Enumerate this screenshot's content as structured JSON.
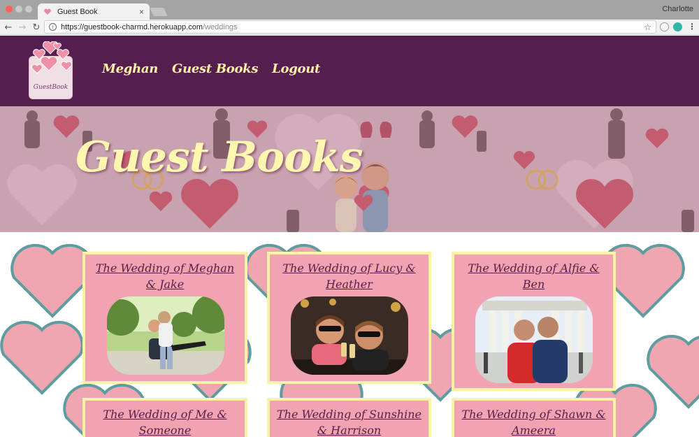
{
  "browser": {
    "tab_title": "Guest Book",
    "tab_close": "×",
    "profile_name": "Charlotte",
    "url_base": "https://guestbook-charmd.herokuapp.com",
    "url_path": "/weddings",
    "back_icon": "←",
    "forward_icon": "→",
    "reload_icon": "↻",
    "info_icon": "i",
    "star_icon": "☆",
    "menu_icon": "⋮"
  },
  "nav": {
    "logo_text": "GuestBook",
    "links": [
      "Meghan",
      "Guest Books",
      "Logout"
    ]
  },
  "hero": {
    "title": "Guest Books"
  },
  "cards": [
    {
      "title": "The Wedding of Meghan & Jake",
      "photo": "couple-carrying-photo"
    },
    {
      "title": "The Wedding of Lucy & Heather",
      "photo": "couple-sunglasses-photo"
    },
    {
      "title": "The Wedding of Alfie & Ben",
      "photo": "couple-courthouse-photo"
    },
    {
      "title": "The Wedding of Me & Someone",
      "photo": ""
    },
    {
      "title": "The Wedding of Sunshine & Harrison",
      "photo": ""
    },
    {
      "title": "The Wedding of Shawn & Ameera",
      "photo": ""
    }
  ],
  "colors": {
    "nav_bg": "#561e4e",
    "nav_link": "#fff2a6",
    "card_bg": "#f2a3b1",
    "card_border": "#fbf3a6",
    "card_title": "#561e4e",
    "heart_fill": "#f0a6b0",
    "heart_stroke": "#5f9ca0"
  }
}
